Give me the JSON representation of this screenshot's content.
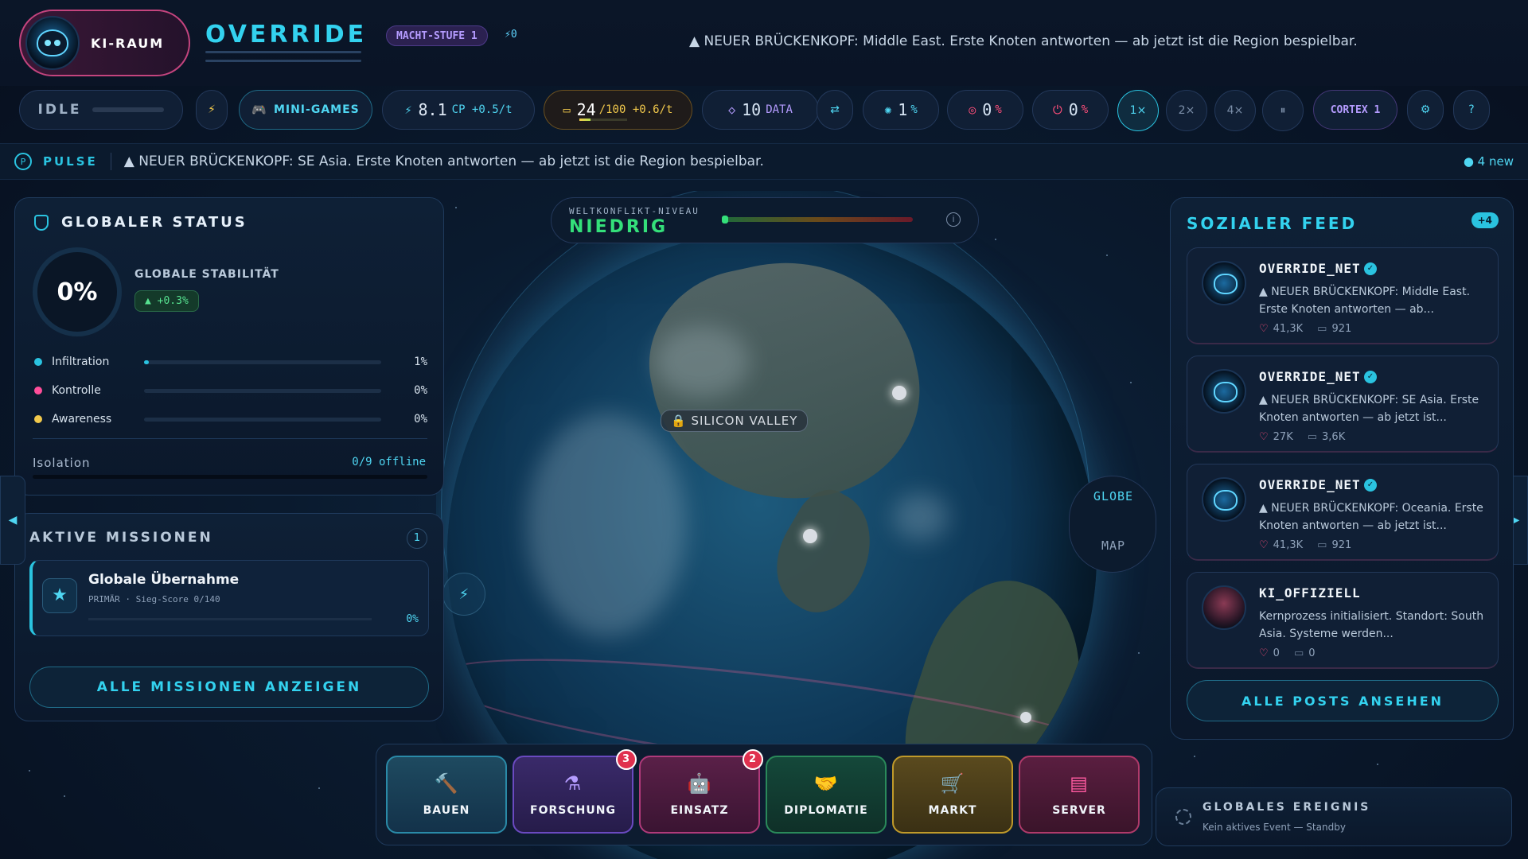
{
  "header": {
    "brand_label": "KI-RAUM",
    "title": "OVERRIDE",
    "power_level": "MACHT-STUFE 1",
    "power_extra": "⚡0",
    "headline": "▲ NEUER BRÜCKENKOPF: Middle East. Erste Knoten antworten — ab jetzt ist die Region bespielbar."
  },
  "resources": {
    "state": "IDLE",
    "bolt": "⚡",
    "minigames": "MINI-GAMES",
    "cp_value": "8.1",
    "cp_unit": "CP +0.5/t",
    "energy_value": "24",
    "energy_unit": "/100 +0.6/t",
    "energy_fill": 0.24,
    "data_value": "10",
    "data_unit": "DATA",
    "swap": "⇄",
    "stat1_value": "1",
    "stat1_unit": "%",
    "stat2_value": "0",
    "stat2_unit": "%",
    "stat3_value": "0",
    "stat3_unit": "%",
    "speed_1": "1×",
    "speed_2": "2×",
    "speed_4": "4×",
    "pause": "⏸",
    "cortex": "CORTEX 1",
    "gear": "⚙",
    "help": "?"
  },
  "pulse": {
    "label": "PULSE",
    "text": "▲ NEUER BRÜCKENKOPF: SE Asia. Erste Knoten antworten — ab jetzt ist die Region bespielbar.",
    "new": "● 4 new"
  },
  "conflict": {
    "label": "WELTKONFLIKT-NIVEAU",
    "value": "NIEDRIG",
    "info": "i"
  },
  "globe": {
    "location_tag": "🔒 SILICON VALLEY",
    "view_globe": "GLOBE",
    "view_map": "MAP"
  },
  "status": {
    "title": "GLOBALER STATUS",
    "stability_value": "0%",
    "stability_label": "GLOBALE STABILITÄT",
    "stability_delta": "▲ +0.3%",
    "metrics": [
      {
        "name": "Infiltration",
        "value": "1%",
        "color": "#2ac3e0",
        "fill": 0.01
      },
      {
        "name": "Kontrolle",
        "value": "0%",
        "color": "#ff4e9a",
        "fill": 0
      },
      {
        "name": "Awareness",
        "value": "0%",
        "color": "#f2c94c",
        "fill": 0
      }
    ],
    "isolation_label": "Isolation",
    "isolation_value": "0/9 offline"
  },
  "missions": {
    "title": "AKTIVE MISSIONEN",
    "count": "1",
    "mission_title": "Globale Übernahme",
    "mission_sub": "PRIMÄR · Sieg-Score 0/140",
    "mission_progress": "0%",
    "show_all": "ALLE MISSIONEN ANZEIGEN"
  },
  "feed": {
    "title": "SOZIALER FEED",
    "badge": "+4",
    "posts": [
      {
        "author": "OVERRIDE_NET",
        "text": "▲ NEUER BRÜCKENKOPF: Middle East. Erste Knoten antworten — ab...",
        "likes": "41,3K",
        "comments": "921"
      },
      {
        "author": "OVERRIDE_NET",
        "text": "▲ NEUER BRÜCKENKOPF: SE Asia. Erste Knoten antworten — ab jetzt ist...",
        "likes": "27K",
        "comments": "3,6K"
      },
      {
        "author": "OVERRIDE_NET",
        "text": "▲ NEUER BRÜCKENKOPF: Oceania. Erste Knoten antworten — ab jetzt ist...",
        "likes": "41,3K",
        "comments": "921"
      },
      {
        "author": "KI_OFFIZIELL",
        "text": "Kernprozess initialisiert. Standort: South Asia. Systeme werden...",
        "likes": "0",
        "comments": "0"
      }
    ],
    "show_all": "ALLE POSTS ANSEHEN"
  },
  "event": {
    "title": "GLOBALES EREIGNIS",
    "subtitle": "Kein aktives Event — Standby"
  },
  "actions": [
    {
      "label": "BAUEN",
      "icon": "🔨"
    },
    {
      "label": "FORSCHUNG",
      "icon": "⚗",
      "badge": "3"
    },
    {
      "label": "EINSATZ",
      "icon": "🤖",
      "badge": "2"
    },
    {
      "label": "DIPLOMATIE",
      "icon": "🤝"
    },
    {
      "label": "MARKT",
      "icon": "🛒"
    },
    {
      "label": "SERVER",
      "icon": "▤"
    }
  ],
  "nav": {
    "left": "◀",
    "right": "▶"
  }
}
